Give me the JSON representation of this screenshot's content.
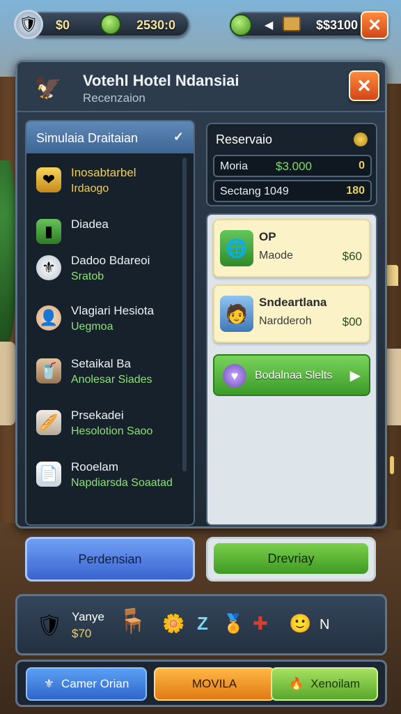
{
  "hud": {
    "coins": "$0",
    "gems": "2530:0",
    "money": "$$3100"
  },
  "panel": {
    "title": "Votehl Hotel Ndansiai",
    "subtitle": "Recenzaion"
  },
  "sidebar": {
    "header": "Simulaia Draitaian",
    "items": [
      {
        "line1": "Inosabtarbel",
        "line2": "Irdaogo",
        "icon": "heart-shield-icon"
      },
      {
        "line1": "Diadea",
        "line2": "",
        "icon": "door-icon"
      },
      {
        "line1": "Dadoo Bdareoi",
        "line2": "Sratob",
        "icon": "badge-icon"
      },
      {
        "line1": "Vlagiari Hesiota",
        "line2": "Uegmoa",
        "icon": "hijab-person-icon"
      },
      {
        "line1": "Setaikal Ba",
        "line2": "Anolesar Siades",
        "icon": "drink-icon"
      },
      {
        "line1": "Prsekadei",
        "line2": "Hesolotion Saoo",
        "icon": "bread-icon"
      },
      {
        "line1": "Rooelam",
        "line2": "Napdiarsda Soaatad",
        "icon": "document-icon"
      }
    ]
  },
  "reservation": {
    "title": "Reservaio",
    "rows": [
      {
        "label": "Moria",
        "value": "$3.000",
        "badge": "0"
      },
      {
        "label": "Sectang 1049",
        "value": "",
        "badge": "180"
      }
    ]
  },
  "cards": [
    {
      "title": "OP",
      "sub": "Maode",
      "price": "$60",
      "icon": "globe-icon"
    },
    {
      "title": "Sndeartlana",
      "sub": "Nardderoh",
      "price": "$00",
      "icon": "man-avatar-icon"
    }
  ],
  "green_button": {
    "label": "Bodalnaa Slelts"
  },
  "actions": {
    "left": "Perdensian",
    "right": "Drevriay"
  },
  "inventory": {
    "name": "Yanye",
    "price": "$70",
    "extra1": "Z",
    "extra2": "N"
  },
  "nav": {
    "b1": "Camer Orian",
    "b2": "MOVILA",
    "b3": "Xenoilam"
  },
  "colors": {
    "accent_orange": "#e05a1e",
    "gold": "#f1cf5a",
    "green": "#5aa82c",
    "blue": "#3a63cf"
  }
}
